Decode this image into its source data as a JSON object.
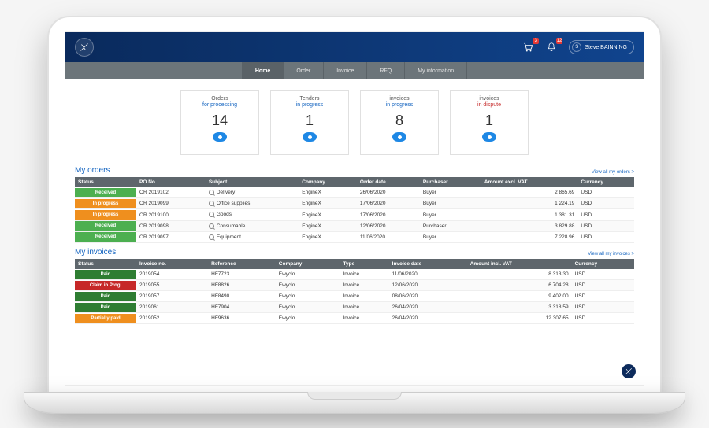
{
  "header": {
    "cart_badge": "3",
    "bell_badge": "12",
    "user_initial": "S",
    "user_name": "Steve BAINNING"
  },
  "nav": {
    "tabs": [
      {
        "label": "Home",
        "active": true
      },
      {
        "label": "Order",
        "active": false
      },
      {
        "label": "Invoice",
        "active": false
      },
      {
        "label": "RFQ",
        "active": false
      },
      {
        "label": "My information",
        "active": false
      }
    ]
  },
  "cards": [
    {
      "line1": "Orders",
      "line2": "for processing",
      "accent": "blue",
      "value": "14"
    },
    {
      "line1": "Tenders",
      "line2": "in progress",
      "accent": "blue",
      "value": "1"
    },
    {
      "line1": "invoices",
      "line2": "in progress",
      "accent": "blue",
      "value": "8"
    },
    {
      "line1": "invoices",
      "line2": "in dispute",
      "accent": "red",
      "value": "1"
    }
  ],
  "orders": {
    "title": "My orders",
    "link": "View all my orders >",
    "columns": [
      "Status",
      "PO No.",
      "Subject",
      "Company",
      "Order date",
      "Purchaser",
      "Amount excl. VAT",
      "Currency"
    ],
    "rows": [
      {
        "status": "Received",
        "status_cls": "st-green",
        "po": "OR 2019102",
        "subject": "Delivery",
        "company": "EngineX",
        "date": "26/06/2020",
        "purchaser": "Buyer",
        "amount": "2 865.69",
        "currency": "USD"
      },
      {
        "status": "In progress",
        "status_cls": "st-orange",
        "po": "OR 2019099",
        "subject": "Office supplies",
        "company": "EngineX",
        "date": "17/06/2020",
        "purchaser": "Buyer",
        "amount": "1 224.19",
        "currency": "USD"
      },
      {
        "status": "In progress",
        "status_cls": "st-orange",
        "po": "OR 2019100",
        "subject": "Goods",
        "company": "EngineX",
        "date": "17/06/2020",
        "purchaser": "Buyer",
        "amount": "1 381.31",
        "currency": "USD"
      },
      {
        "status": "Received",
        "status_cls": "st-green",
        "po": "OR 2019098",
        "subject": "Consumable",
        "company": "EngineX",
        "date": "12/06/2020",
        "purchaser": "Purchaser",
        "amount": "3 829.88",
        "currency": "USD"
      },
      {
        "status": "Received",
        "status_cls": "st-green",
        "po": "OR 2019097",
        "subject": "Equipment",
        "company": "EngineX",
        "date": "11/06/2020",
        "purchaser": "Buyer",
        "amount": "7 228.96",
        "currency": "USD"
      }
    ]
  },
  "invoices": {
    "title": "My invoices",
    "link": "View all my invoices >",
    "columns": [
      "Status",
      "Invoice no.",
      "Reference",
      "Company",
      "Type",
      "Invoice date",
      "Amount incl. VAT",
      "Currency"
    ],
    "rows": [
      {
        "status": "Paid",
        "status_cls": "st-darkgreen",
        "no": "2019054",
        "ref": "HF7723",
        "company": "Ewyclo",
        "type": "Invoice",
        "date": "11/06/2020",
        "amount": "8 313.30",
        "currency": "USD"
      },
      {
        "status": "Claim in Prog.",
        "status_cls": "st-red",
        "no": "2019055",
        "ref": "HF8826",
        "company": "Ewyclo",
        "type": "Invoice",
        "date": "12/06/2020",
        "amount": "6 704.28",
        "currency": "USD"
      },
      {
        "status": "Paid",
        "status_cls": "st-darkgreen",
        "no": "2019057",
        "ref": "HF8490",
        "company": "Ewyclo",
        "type": "Invoice",
        "date": "08/06/2020",
        "amount": "9 402.00",
        "currency": "USD"
      },
      {
        "status": "Paid",
        "status_cls": "st-darkgreen",
        "no": "2019061",
        "ref": "HF7904",
        "company": "Ewyclo",
        "type": "Invoice",
        "date": "26/04/2020",
        "amount": "3 318.59",
        "currency": "USD"
      },
      {
        "status": "Partially paid",
        "status_cls": "st-orange",
        "no": "2019052",
        "ref": "HF9636",
        "company": "Ewyclo",
        "type": "Invoice",
        "date": "26/04/2020",
        "amount": "12 307.65",
        "currency": "USD"
      }
    ]
  }
}
